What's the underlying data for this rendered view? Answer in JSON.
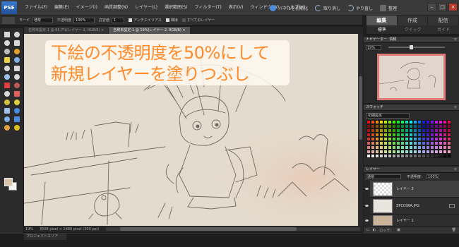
{
  "app": {
    "logo": "PSE"
  },
  "menu": {
    "items": [
      "ファイル(F)",
      "編集(E)",
      "イメージ(I)",
      "画質調整(N)",
      "レイヤー(L)",
      "選択範囲(S)",
      "フィルター(T)",
      "表示(V)",
      "ウィンドウ(W)",
      "ヘルプ(H)"
    ],
    "fix_label": "パネルを初期化",
    "undo_label": "取り消し",
    "redo_label": "やり直し",
    "organizer_label": "整理"
  },
  "options_bar": {
    "mode_label": "モード",
    "mode_value": "通常",
    "opacity_label": "不透明度",
    "opacity_value": "100%",
    "tolerance_label": "許容値",
    "tolerance_value": "1",
    "antialias_label": "アンチエイリアス",
    "contiguous_label": "隣接",
    "all_layers_label": "すべてのレイヤー"
  },
  "mode_tabs": [
    "編集",
    "作成",
    "配信"
  ],
  "sub_tabs": [
    "標準",
    "クイック",
    "ガイド"
  ],
  "doc_tabs": [
    {
      "label": "名称未設定-1 @ 66.7%(レイヤー 2, RGB/8) ×",
      "active": false
    },
    {
      "label": "名称未設定-1 @ 19%(レイヤー 2, RGB/8) ×",
      "active": true
    }
  ],
  "annotation": {
    "line1": "下絵の不透明度を50%にして",
    "line2": "新規レイヤーを塗りつぶし",
    "color": "#ff8a2a"
  },
  "status": {
    "zoom": "19%",
    "doc_info": "3508 pixel × 2480 pixel (300 ppi)"
  },
  "project_bin_label": "プロジェクトエリア",
  "navigator": {
    "title": "ナビゲーター",
    "tab2": "情報",
    "zoom": "19%",
    "zoom_level": 0.4
  },
  "swatches": {
    "title": "スウォッチ",
    "set": "初期設定"
  },
  "layers": {
    "title": "レイヤー",
    "blend_mode": "通常",
    "opacity_label": "不透明度：",
    "opacity_value": "100%",
    "items": [
      {
        "name": "レイヤー 3",
        "thumb": "transparent",
        "active": true
      },
      {
        "name": "ZPC0SRA.JPG",
        "thumb": "sketch",
        "active": false
      },
      {
        "name": "レイヤー 1",
        "thumb": "fill",
        "active": false
      }
    ],
    "lock_label": "ロック："
  },
  "tools": [
    "move-tool",
    "zoom-tool",
    "hand-tool",
    "eyedropper-tool",
    "marquee-tool",
    "lasso-tool",
    "magic-wand-tool",
    "quick-select-tool",
    "type-tool",
    "crop-tool",
    "cookie-cutter-tool",
    "straighten-tool",
    "red-eye-tool",
    "healing-brush-tool",
    "clone-stamp-tool",
    "eraser-tool",
    "pencil-tool",
    "brush-tool",
    "smart-brush-tool",
    "blur-tool",
    "sponge-tool",
    "paint-bucket-tool",
    "gradient-tool",
    "shape-tool"
  ],
  "colors": {
    "foreground": "#d8c2a8",
    "background": "#f4f4f4",
    "accent_red": "#e07a78"
  }
}
